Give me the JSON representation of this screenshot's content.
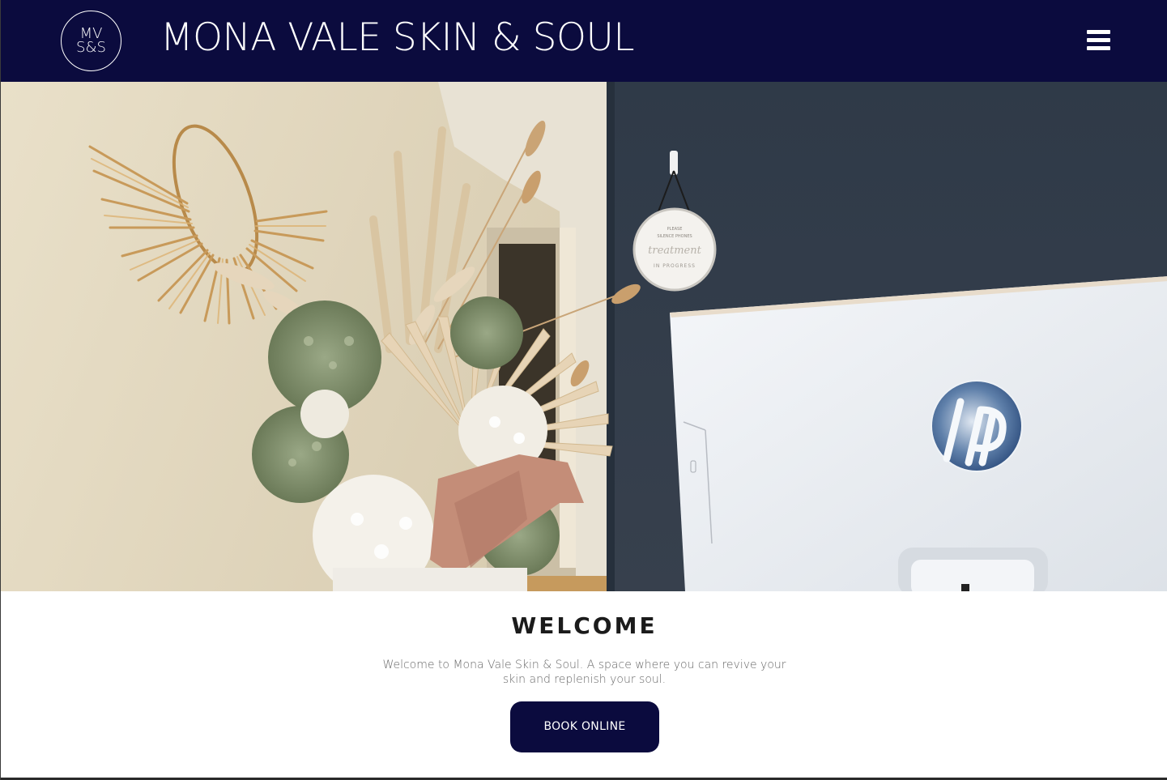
{
  "header": {
    "logo_line1": "MV",
    "logo_line2": "S&S",
    "site_title": "MONA VALE SKIN & SOUL",
    "menu_icon": "hamburger-menu-icon"
  },
  "hero": {
    "image_subject": "dried flower arrangement, woven wall hanging and reception computer",
    "sign_line1": "PLEASE",
    "sign_line2": "SILENCE PHONES",
    "sign_line3": "treatment",
    "sign_line4": "IN PROGRESS"
  },
  "welcome": {
    "heading": "WELCOME",
    "text": "Welcome to Mona Vale Skin & Soul. A space where you can revive your skin and replenish your soul.",
    "button_label": "BOOK ONLINE"
  },
  "colors": {
    "brand_navy": "#0b0b3e",
    "text_dark": "#1b1b1b",
    "text_muted": "#6a6a6a"
  }
}
